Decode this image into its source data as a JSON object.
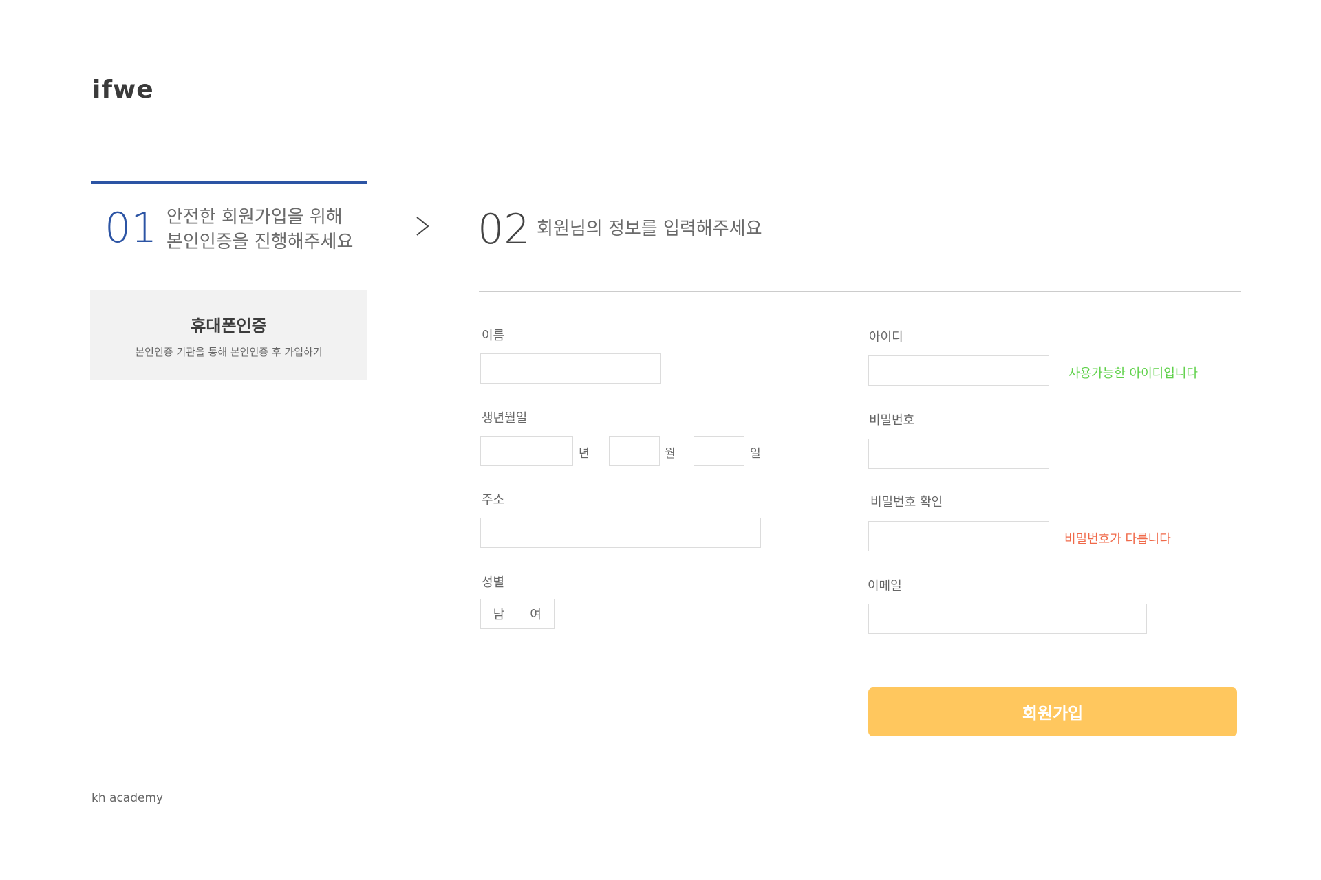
{
  "brand": {
    "logo": "ifwe"
  },
  "step1": {
    "number": "01",
    "text": "안전한 회원가입을 위해\n본인인증을 진행해주세요"
  },
  "step2": {
    "number": "02",
    "text": "회원님의 정보를 입력해주세요"
  },
  "phone_auth": {
    "title": "휴대폰인증",
    "subtitle": "본인인증 기관을 통해 본인인증 후 가입하기"
  },
  "form": {
    "name_label": "이름",
    "birth_label": "생년월일",
    "birth_year_unit": "년",
    "birth_month_unit": "월",
    "birth_day_unit": "일",
    "address_label": "주소",
    "gender_label": "성별",
    "gender_options": [
      "남",
      "여"
    ],
    "id_label": "아이디",
    "id_message": "사용가능한 아이디입니다",
    "password_label": "비밀번호",
    "password_confirm_label": "비밀번호 확인",
    "password_message": "비밀번호가 다릅니다",
    "email_label": "이메일",
    "submit_label": "회원가입"
  },
  "colors": {
    "accent_blue": "#2c54a4",
    "success_green": "#5fd14a",
    "error_red": "#f06a4a",
    "submit_yellow": "#ffc75e"
  },
  "footer": {
    "text": "kh academy"
  }
}
